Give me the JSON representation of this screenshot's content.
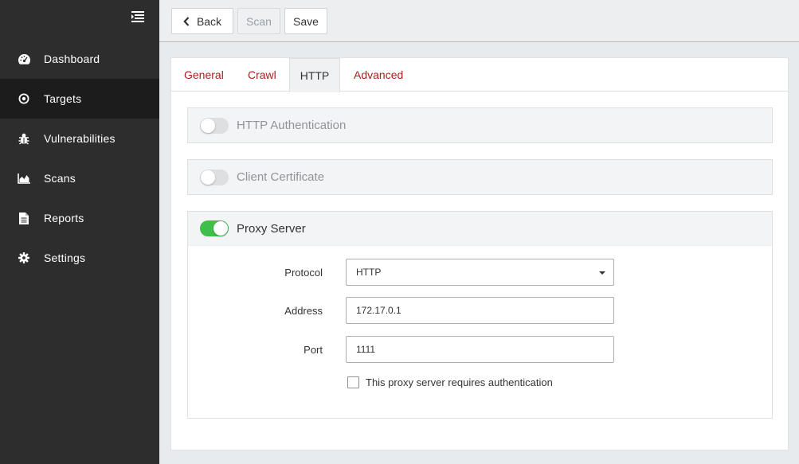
{
  "sidebar": {
    "items": [
      {
        "label": "Dashboard",
        "icon": "dashboard-gauge-icon"
      },
      {
        "label": "Targets",
        "icon": "target-icon"
      },
      {
        "label": "Vulnerabilities",
        "icon": "bug-icon"
      },
      {
        "label": "Scans",
        "icon": "area-chart-icon"
      },
      {
        "label": "Reports",
        "icon": "document-icon"
      },
      {
        "label": "Settings",
        "icon": "gear-icon"
      }
    ],
    "active_item": "Targets"
  },
  "toolbar": {
    "back_label": "Back",
    "scan_label": "Scan",
    "save_label": "Save"
  },
  "tabs": [
    {
      "label": "General"
    },
    {
      "label": "Crawl"
    },
    {
      "label": "HTTP"
    },
    {
      "label": "Advanced"
    }
  ],
  "active_tab": "HTTP",
  "sections": {
    "http_auth": {
      "title": "HTTP Authentication",
      "enabled": false
    },
    "client_cert": {
      "title": "Client Certificate",
      "enabled": false
    },
    "proxy": {
      "title": "Proxy Server",
      "enabled": true,
      "protocol_label": "Protocol",
      "protocol_value": "HTTP",
      "address_label": "Address",
      "address_value": "172.17.0.1",
      "port_label": "Port",
      "port_value": "1111",
      "auth_checkbox_label": "This proxy server requires authentication",
      "auth_checkbox_checked": false
    }
  },
  "colors": {
    "sidebar_bg": "#2d2d2d",
    "sidebar_active_bg": "#1c1c1c",
    "tab_link": "#b01c1c",
    "toggle_on": "#3fbf4a",
    "toggle_off": "#dedfe0"
  }
}
